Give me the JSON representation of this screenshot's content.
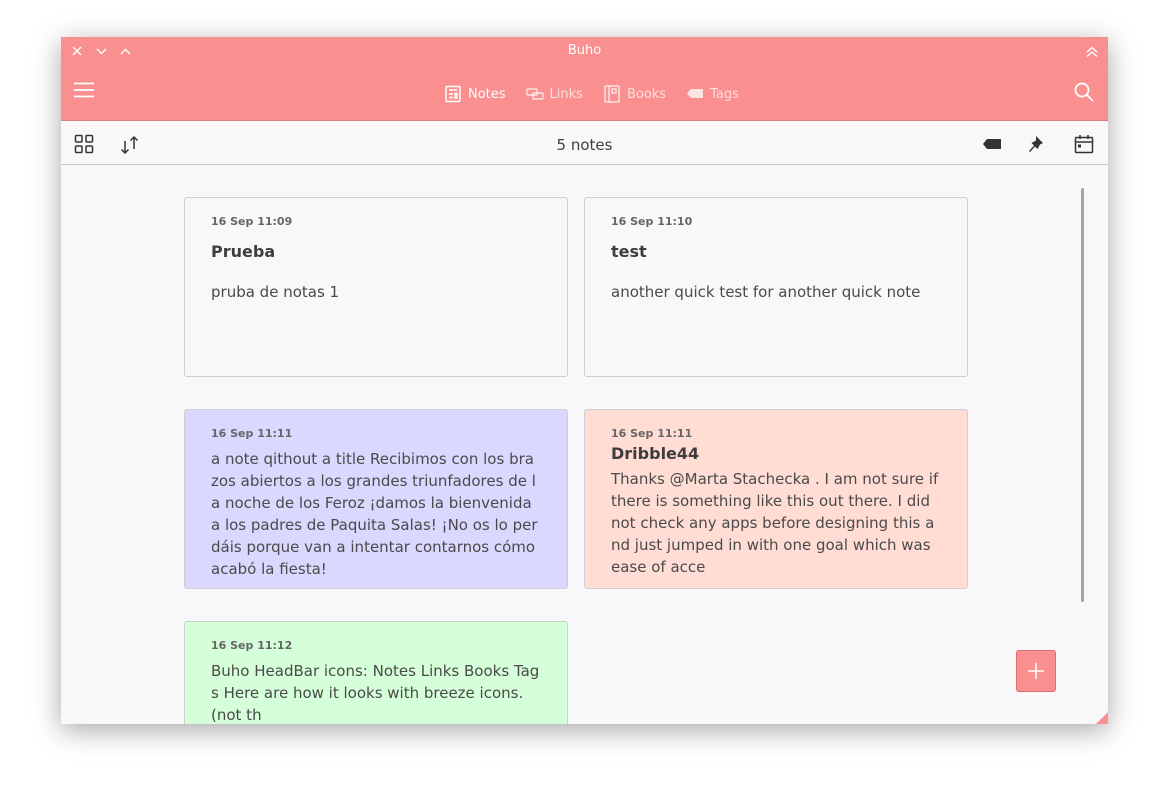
{
  "window": {
    "title": "Buho"
  },
  "headbar": {
    "tabs": [
      {
        "label": "Notes",
        "icon": "notes-icon",
        "active": true
      },
      {
        "label": "Links",
        "icon": "links-icon",
        "active": false
      },
      {
        "label": "Books",
        "icon": "books-icon",
        "active": false
      },
      {
        "label": "Tags",
        "icon": "tags-icon",
        "active": false
      }
    ]
  },
  "toolbar": {
    "count_label": "5 notes"
  },
  "notes": [
    {
      "date": "16 Sep 11:09",
      "title": "Prueba",
      "body": "pruba de notas 1",
      "color": "#f8f8fa"
    },
    {
      "date": "16 Sep 11:10",
      "title": "test",
      "body": "another quick test for another quick note",
      "color": "#f8f8fa"
    },
    {
      "date": "16 Sep 11:11",
      "title": "",
      "body": "a note qithout a title Recibimos con los brazos abiertos a los grandes triunfadores de la noche de los Feroz ¡damos la bienvenida a los padres de Paquita Salas! ¡No os lo perdáis porque van a intentar contarnos cómo acabó la fiesta!",
      "color": "#dad8ff"
    },
    {
      "date": "16 Sep 11:11",
      "title": "Dribble44",
      "body": "Thanks @Marta Stachecka . I am not sure if there is something like this out there. I did not check any apps before designing this and just jumped in with one goal which was ease of acce",
      "color": "#ffddd4"
    },
    {
      "date": "16 Sep 11:12",
      "title": "",
      "body": "Buho HeadBar icons: Notes Links Books Tags Here are how it looks with breeze icons. (not th",
      "color": "#d4ffd8"
    }
  ],
  "colors": {
    "accent": "#fa8f8f",
    "background": "#f8f8fa"
  }
}
